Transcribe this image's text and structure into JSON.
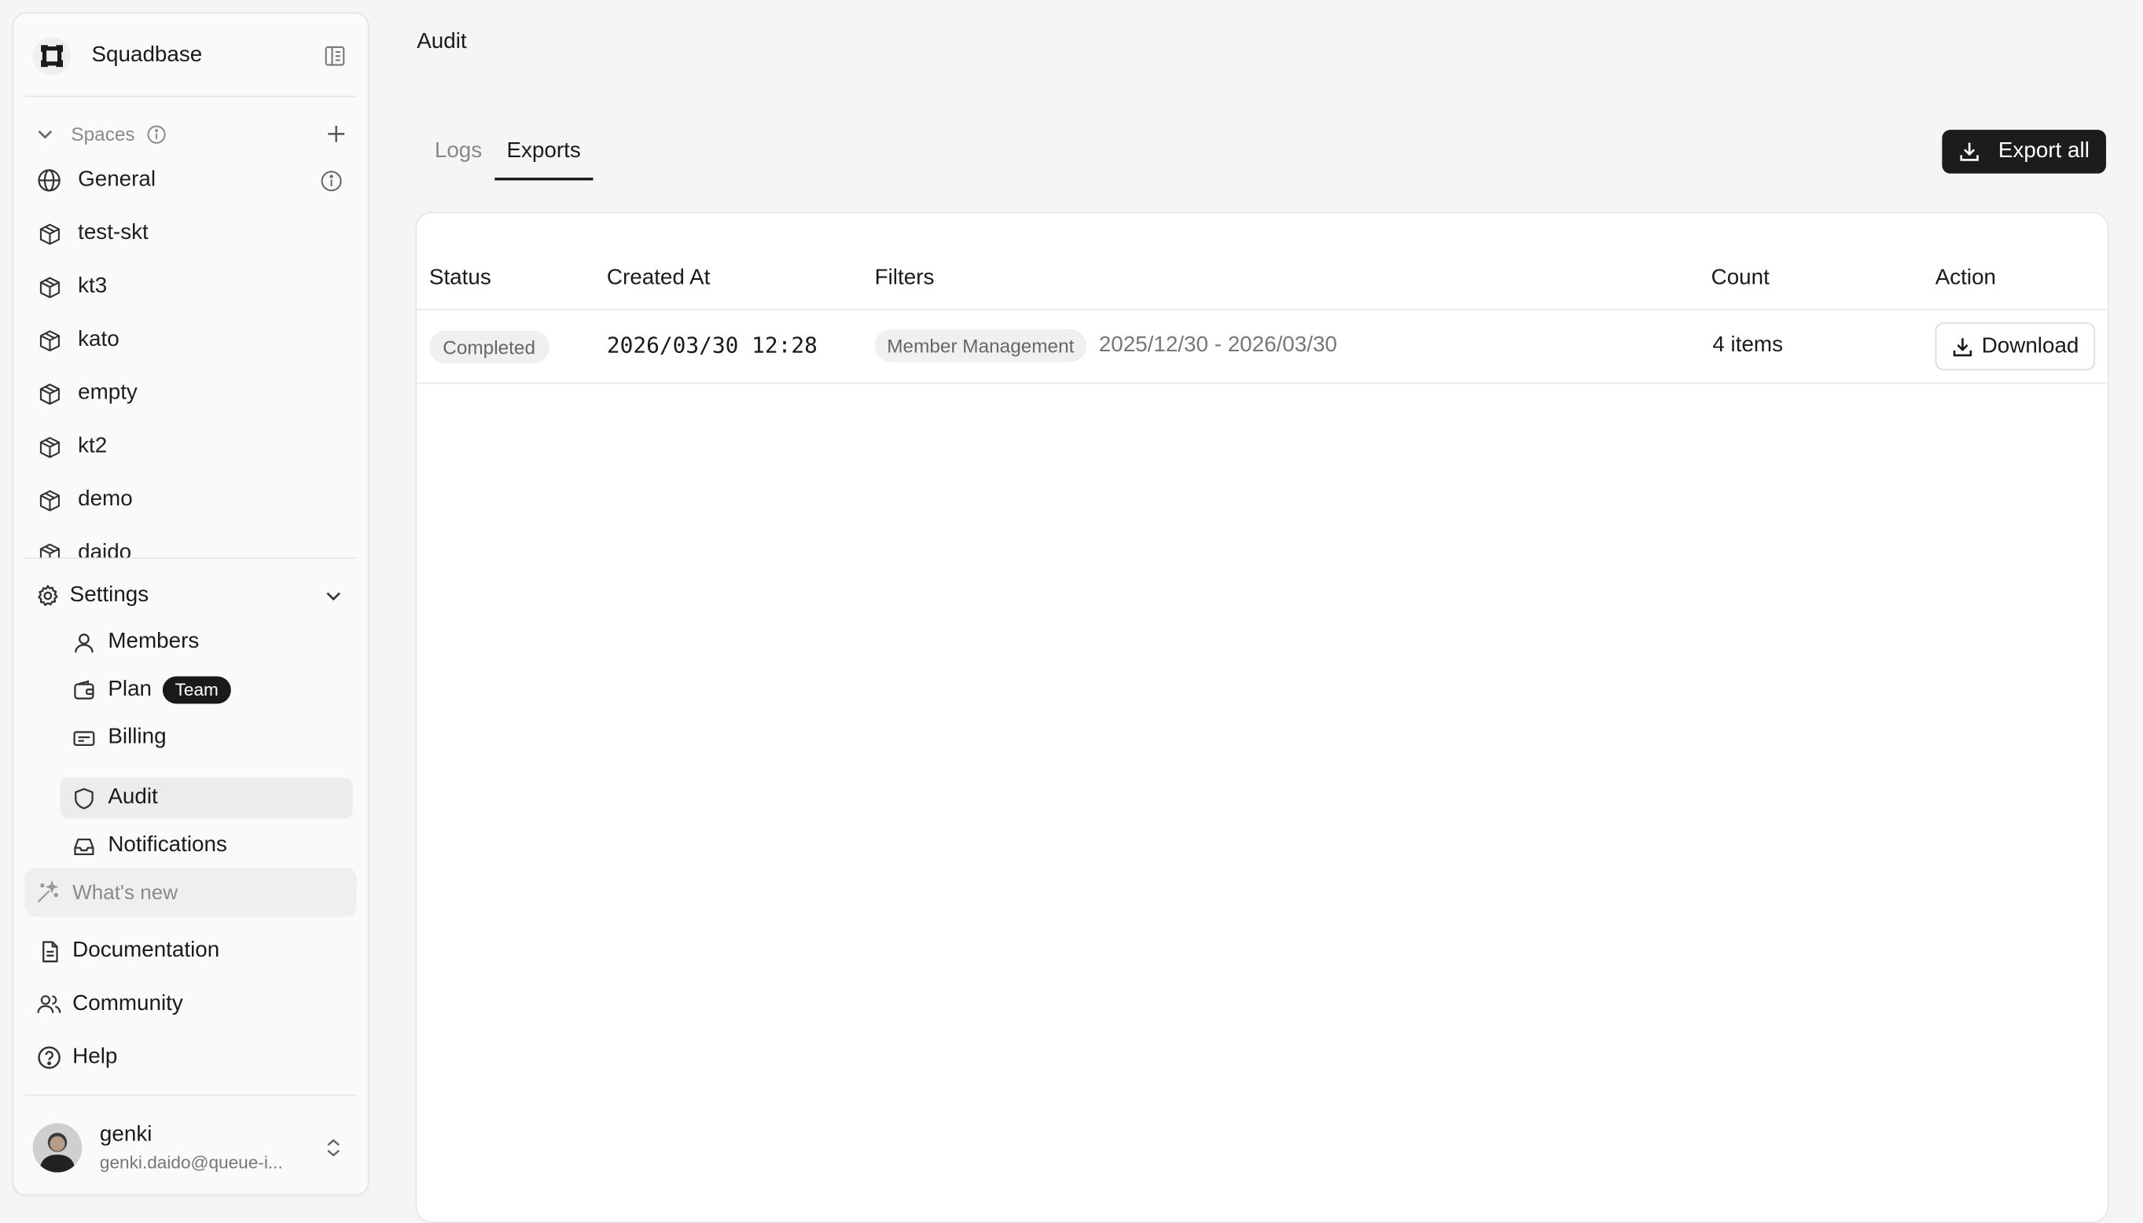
{
  "app": {
    "name": "Squadbase"
  },
  "sidebar": {
    "spaces_label": "Spaces",
    "spaces": [
      {
        "label": "General",
        "icon": "globe-icon"
      },
      {
        "label": "test-skt",
        "icon": "cube-icon"
      },
      {
        "label": "kt3",
        "icon": "cube-icon"
      },
      {
        "label": "kato",
        "icon": "cube-icon"
      },
      {
        "label": "empty",
        "icon": "cube-icon"
      },
      {
        "label": "kt2",
        "icon": "cube-icon"
      },
      {
        "label": "demo",
        "icon": "cube-icon"
      },
      {
        "label": "daido",
        "icon": "cube-icon"
      }
    ],
    "settings_label": "Settings",
    "settings_items": [
      {
        "label": "Members",
        "icon": "user-icon"
      },
      {
        "label": "Plan",
        "icon": "wallet-icon",
        "badge": "Team"
      },
      {
        "label": "Billing",
        "icon": "card-icon"
      },
      {
        "label": "Audit",
        "icon": "shield-icon"
      },
      {
        "label": "Notifications",
        "icon": "inbox-icon"
      }
    ],
    "whats_new": "What's new",
    "footer_items": [
      {
        "label": "Documentation",
        "icon": "document-icon"
      },
      {
        "label": "Community",
        "icon": "users-icon"
      },
      {
        "label": "Help",
        "icon": "help-icon"
      }
    ],
    "user": {
      "name": "genki",
      "email": "genki.daido@queue-i..."
    }
  },
  "main": {
    "title": "Audit",
    "tabs": [
      {
        "label": "Logs"
      },
      {
        "label": "Exports"
      }
    ],
    "export_all": "Export all",
    "table": {
      "headers": [
        "Status",
        "Created At",
        "Filters",
        "Count",
        "Action"
      ],
      "rows": [
        {
          "status": "Completed",
          "created_at": "2026/03/30 12:28",
          "filter_tag": "Member Management",
          "date_range": "2025/12/30 - 2026/03/30",
          "count": "4 items",
          "action": "Download"
        }
      ]
    }
  },
  "colors": {
    "primary_button": "#1c1c1c",
    "active_nav": "#ececec",
    "background": "#f5f5f5"
  }
}
